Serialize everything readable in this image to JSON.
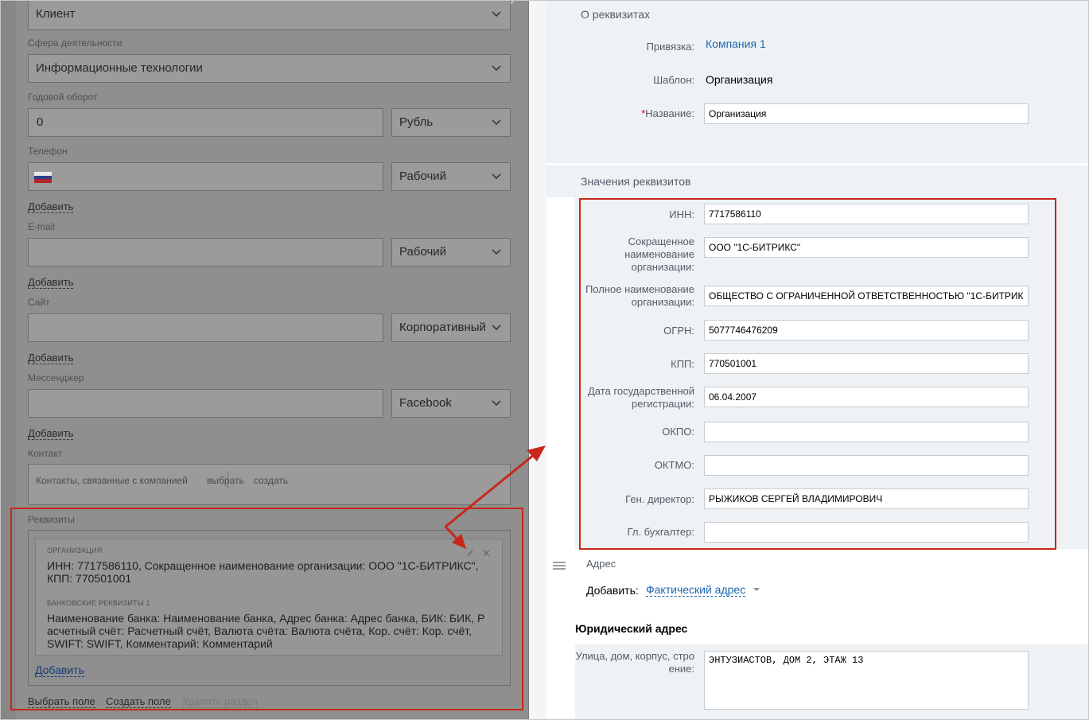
{
  "left_form": {
    "type_value": "Клиент",
    "industry": {
      "label": "Сфера деятельности",
      "value": "Информационные технологии"
    },
    "revenue": {
      "label": "Годовой оборот",
      "value": "0",
      "currency": "Рубль"
    },
    "phone": {
      "label": "Телефон",
      "value": "",
      "type": "Рабочий",
      "add": "Добавить"
    },
    "email": {
      "label": "E-mail",
      "value": "",
      "type": "Рабочий",
      "add": "Добавить"
    },
    "site": {
      "label": "Сайт",
      "value": "",
      "type": "Корпоративный",
      "add": "Добавить"
    },
    "messenger": {
      "label": "Мессенджер",
      "value": "",
      "type": "Facebook",
      "add": "Добавить"
    },
    "contact": {
      "label": "Контакт",
      "placeholder": "Контакты, связанные с компанией",
      "select": "выбрать",
      "create": "создать"
    },
    "requisites": {
      "label": "Реквизиты",
      "org_caption": "ОРГАНИЗАЦИЯ",
      "org_line1": "ИНН: 7717586110, Сокращенное наименование организации: ООО \"1С-БИТРИКС\",",
      "org_line2": "КПП: 770501001",
      "bank_caption": "БАНКОВСКИЕ РЕКВИЗИТЫ 1",
      "bank_line1": "Наименование банка: Наименование банка, Адрес банка: Адрес банка, БИК: БИК, Р",
      "bank_line2": "асчетный счёт: Расчетный счёт, Валюта счёта: Валюта счёта, Кор. счёт: Кор. счёт,",
      "bank_line3": "SWIFT: SWIFT, Комментарий: Комментарий",
      "add": "Добавить"
    },
    "footer": {
      "select_field": "Выбрать поле",
      "create_field": "Создать поле",
      "delete_section": "Удалить раздел"
    }
  },
  "right_panel": {
    "about": {
      "title": "О реквизитах",
      "binding_label": "Привязка:",
      "binding_value": "Компания 1",
      "template_label": "Шаблон:",
      "template_value": "Организация",
      "required_star": "*",
      "name_label": "Название:",
      "name_value": "Организация"
    },
    "values": {
      "title": "Значения реквизитов",
      "inn": {
        "label": "ИНН:",
        "value": "7717586110"
      },
      "short_name": {
        "label_1": "Сокращенное",
        "label_2": "наименование",
        "label_3": "организации:",
        "value": "ООО \"1С-БИТРИКС\""
      },
      "full_name": {
        "label_1": "Полное наименование",
        "label_2": "организации:",
        "value": "ОБЩЕСТВО С ОГРАНИЧЕННОЙ ОТВЕТСТВЕННОСТЬЮ \"1С-БИТРИК"
      },
      "ogrn": {
        "label": "ОГРН:",
        "value": "5077746476209"
      },
      "kpp": {
        "label": "КПП:",
        "value": "770501001"
      },
      "reg_date": {
        "label_1": "Дата государственной",
        "label_2": "регистрации:",
        "value": "06.04.2007"
      },
      "okpo": {
        "label": "ОКПО:",
        "value": ""
      },
      "oktmo": {
        "label": "ОКТМО:",
        "value": ""
      },
      "director": {
        "label": "Ген. директор:",
        "value": "РЫЖИКОВ СЕРГЕЙ ВЛАДИМИРОВИЧ"
      },
      "accountant": {
        "label": "Гл. бухгалтер:",
        "value": ""
      }
    },
    "address": {
      "title": "Адрес",
      "add_label": "Добавить:",
      "add_link": "Фактический адрес",
      "legal_title": "Юридический адрес",
      "street_label_1": "Улица, дом, корпус, стро",
      "street_label_2": "ение:",
      "street_value": "ЭНТУЗИАСТОВ, ДОМ 2, ЭТАЖ 13"
    }
  },
  "colors": {
    "highlight_red": "#c8271b",
    "link_blue": "#2067b0",
    "section_bg": "#eef2f4",
    "dim_overlay": "#8f8f8f"
  },
  "icons": [
    "chevron-down-icon",
    "russia-flag-icon",
    "pencil-icon",
    "close-icon",
    "drag-handle-icon",
    "caret-down-icon",
    "arrow-icon"
  ]
}
